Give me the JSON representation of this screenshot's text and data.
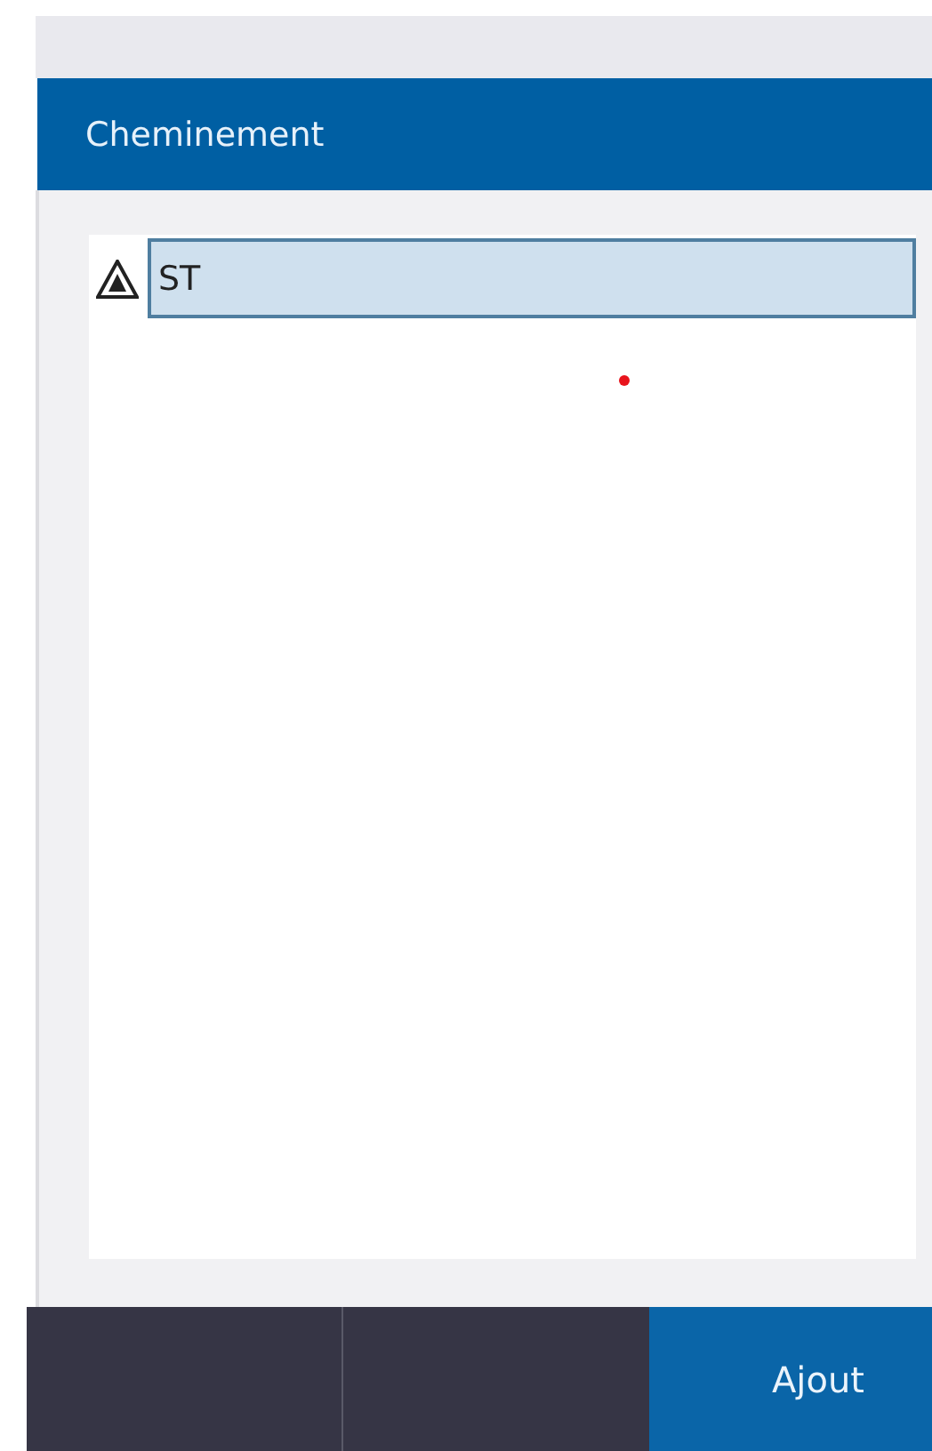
{
  "header": {
    "title": "Cheminement"
  },
  "rows": [
    {
      "kind": "warning",
      "value": "ST",
      "selected": true
    }
  ],
  "footer": {
    "action": "Ajout"
  }
}
